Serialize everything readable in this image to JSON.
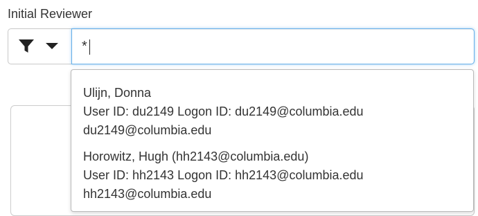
{
  "field": {
    "label": "Initial Reviewer"
  },
  "filter": {
    "icon": "filter-icon",
    "dropdown_icon": "caret-down-icon"
  },
  "search": {
    "value": "*",
    "focus_color": "#66afe9"
  },
  "suggestions": [
    {
      "name": "Ulijn, Donna",
      "ids": "User ID: du2149 Logon ID: du2149@columbia.edu",
      "email": "du2149@columbia.edu"
    },
    {
      "name": "Horowitz, Hugh (hh2143@columbia.edu)",
      "ids": "User ID: hh2143 Logon ID: hh2143@columbia.edu",
      "email": "hh2143@columbia.edu"
    }
  ]
}
